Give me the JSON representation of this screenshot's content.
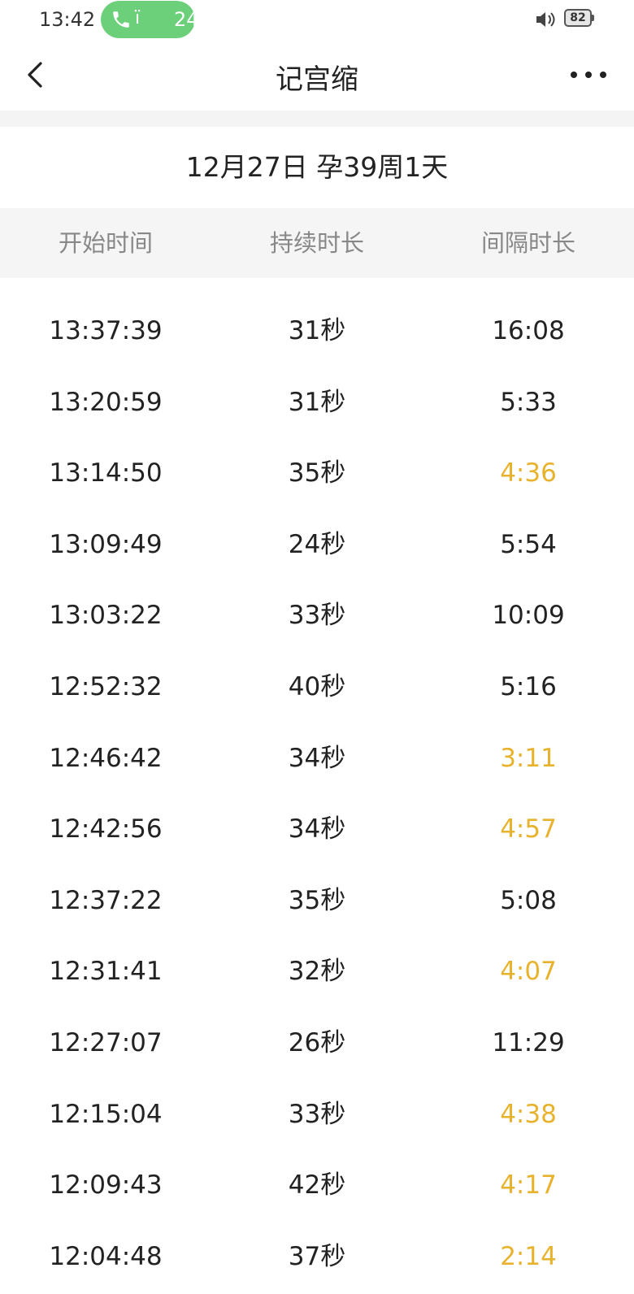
{
  "status_bar": {
    "time": "13:42",
    "call_glyph": "ï",
    "call_duration": "24",
    "battery_level": "82",
    "icons": [
      "phone-icon",
      "volume-icon",
      "battery-icon"
    ]
  },
  "nav": {
    "title": "记宫缩",
    "icons": [
      "back-arrow-icon",
      "more-dots-icon"
    ]
  },
  "date_header": "12月27日 孕39周1天",
  "columns": [
    "开始时间",
    "持续时长",
    "间隔时长"
  ],
  "highlight_color": "#e8b22c",
  "records": [
    {
      "start": "13:37:39",
      "duration": "31秒",
      "interval": "16:08",
      "highlight": false
    },
    {
      "start": "13:20:59",
      "duration": "31秒",
      "interval": "5:33",
      "highlight": false
    },
    {
      "start": "13:14:50",
      "duration": "35秒",
      "interval": "4:36",
      "highlight": true
    },
    {
      "start": "13:09:49",
      "duration": "24秒",
      "interval": "5:54",
      "highlight": false
    },
    {
      "start": "13:03:22",
      "duration": "33秒",
      "interval": "10:09",
      "highlight": false
    },
    {
      "start": "12:52:32",
      "duration": "40秒",
      "interval": "5:16",
      "highlight": false
    },
    {
      "start": "12:46:42",
      "duration": "34秒",
      "interval": "3:11",
      "highlight": true
    },
    {
      "start": "12:42:56",
      "duration": "34秒",
      "interval": "4:57",
      "highlight": true
    },
    {
      "start": "12:37:22",
      "duration": "35秒",
      "interval": "5:08",
      "highlight": false
    },
    {
      "start": "12:31:41",
      "duration": "32秒",
      "interval": "4:07",
      "highlight": true
    },
    {
      "start": "12:27:07",
      "duration": "26秒",
      "interval": "11:29",
      "highlight": false
    },
    {
      "start": "12:15:04",
      "duration": "33秒",
      "interval": "4:38",
      "highlight": true
    },
    {
      "start": "12:09:43",
      "duration": "42秒",
      "interval": "4:17",
      "highlight": true
    },
    {
      "start": "12:04:48",
      "duration": "37秒",
      "interval": "2:14",
      "highlight": true
    }
  ]
}
